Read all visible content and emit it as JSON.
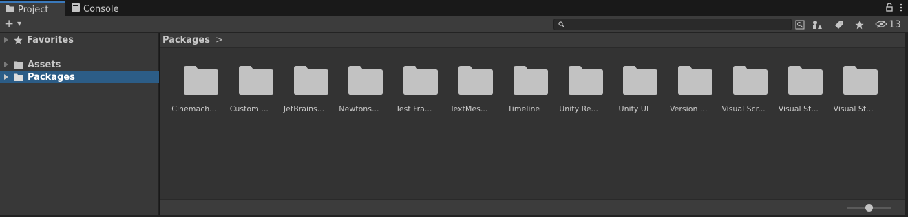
{
  "tabs": [
    {
      "label": "Project",
      "icon": "folder-icon",
      "active": true
    },
    {
      "label": "Console",
      "icon": "console-icon",
      "active": false
    }
  ],
  "toolbar": {
    "hidden_count": "13",
    "search_value": "",
    "icons": [
      "plus-icon",
      "search-icon",
      "search-by-type-icon",
      "filter-label-icon",
      "favorite-star-icon",
      "hidden-packages-icon"
    ]
  },
  "sidebar": {
    "items": [
      {
        "label": "Favorites",
        "icon": "star-icon",
        "selected": false
      },
      {
        "label": "Assets",
        "icon": "folder-icon",
        "selected": false
      },
      {
        "label": "Packages",
        "icon": "folder-icon",
        "selected": true
      }
    ]
  },
  "breadcrumb": {
    "path": "Packages",
    "separator": ">"
  },
  "folders": [
    "Cinemach...",
    "Custom ...",
    "JetBrains...",
    "Newtons...",
    "Test Fra...",
    "TextMes...",
    "Timeline",
    "Unity Re...",
    "Unity UI",
    "Version ...",
    "Visual Scr...",
    "Visual St...",
    "Visual St..."
  ],
  "footer": {
    "zoom_level": 0.5
  },
  "colors": {
    "accent": "#3a79bb",
    "selection": "#2c5d87",
    "folder": "#c2c2c2"
  }
}
